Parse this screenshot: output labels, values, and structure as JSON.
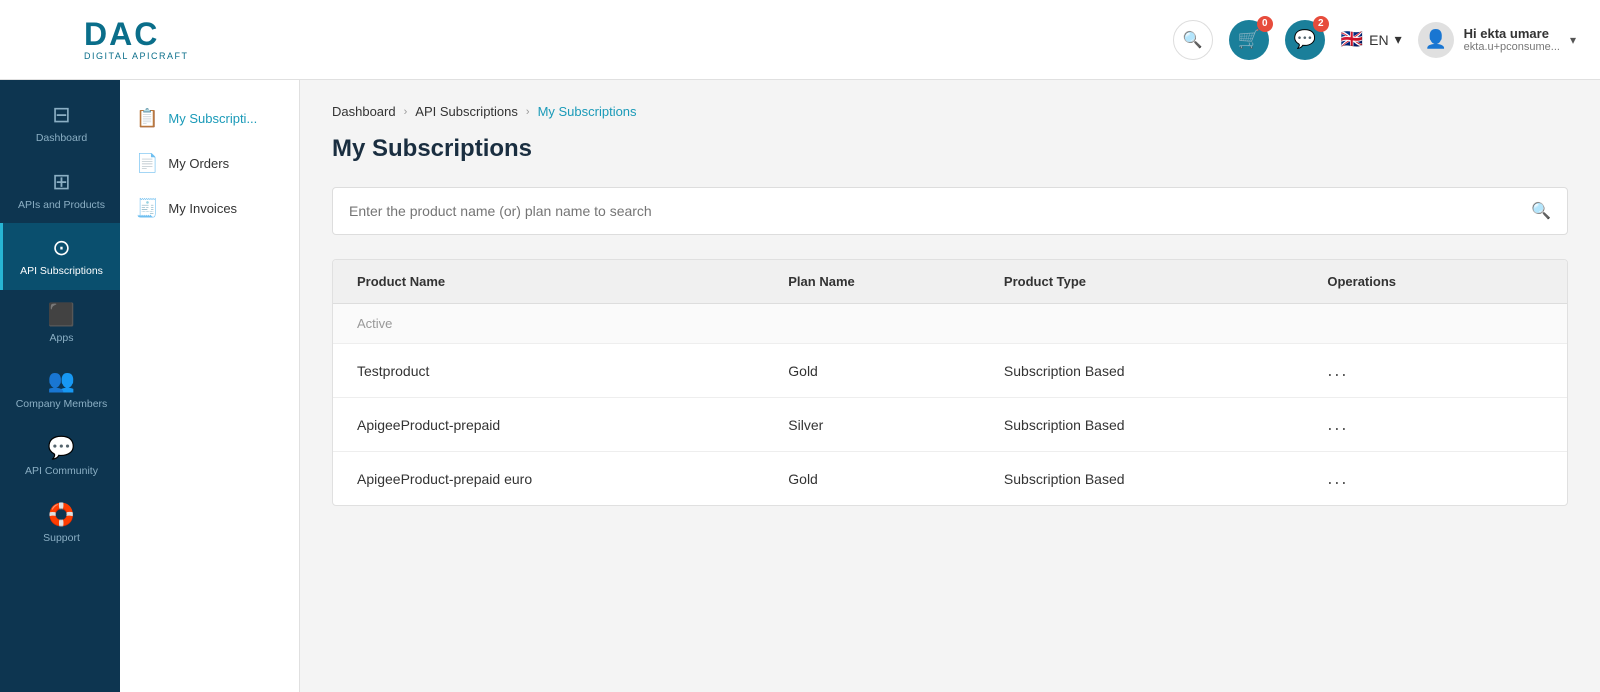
{
  "header": {
    "logo_main": "DAC",
    "logo_sub": "DIGITAL APICRAFT",
    "search_btn_title": "Search",
    "cart_count": "0",
    "notifications_count": "2",
    "language": "EN",
    "user_greeting": "Hi ekta umare",
    "user_email": "ekta.u+pconsume..."
  },
  "sidebar": {
    "items": [
      {
        "id": "dashboard",
        "label": "Dashboard",
        "icon": "⊟"
      },
      {
        "id": "apis-products",
        "label": "APIs and Products",
        "icon": "⊞"
      },
      {
        "id": "api-subscriptions",
        "label": "API Subscriptions",
        "icon": "⊙"
      },
      {
        "id": "apps",
        "label": "Apps",
        "icon": "⬛"
      },
      {
        "id": "company-members",
        "label": "Company Members",
        "icon": "👥"
      },
      {
        "id": "api-community",
        "label": "API Community",
        "icon": "💬"
      },
      {
        "id": "support",
        "label": "Support",
        "icon": "🛟"
      }
    ]
  },
  "secondary_sidebar": {
    "items": [
      {
        "id": "my-subscriptions",
        "label": "My Subscripti...",
        "icon": "📋",
        "active": true
      },
      {
        "id": "my-orders",
        "label": "My Orders",
        "icon": "📄"
      },
      {
        "id": "my-invoices",
        "label": "My Invoices",
        "icon": "🧾"
      }
    ]
  },
  "breadcrumb": {
    "items": [
      {
        "label": "Dashboard",
        "active": false
      },
      {
        "label": "API Subscriptions",
        "active": false
      },
      {
        "label": "My Subscriptions",
        "active": true
      }
    ]
  },
  "page": {
    "title": "My Subscriptions",
    "search_placeholder": "Enter the product name (or) plan name to search"
  },
  "table": {
    "columns": [
      "Product Name",
      "Plan Name",
      "Product Type",
      "Operations"
    ],
    "sections": [
      {
        "label": "Active",
        "rows": [
          {
            "product": "Testproduct",
            "plan": "Gold",
            "type": "Subscription Based",
            "ops": "..."
          },
          {
            "product": "ApigeeProduct-prepaid",
            "plan": "Silver",
            "type": "Subscription Based",
            "ops": "..."
          },
          {
            "product": "ApigeeProduct-prepaid euro",
            "plan": "Gold",
            "type": "Subscription Based",
            "ops": "..."
          }
        ]
      }
    ]
  }
}
